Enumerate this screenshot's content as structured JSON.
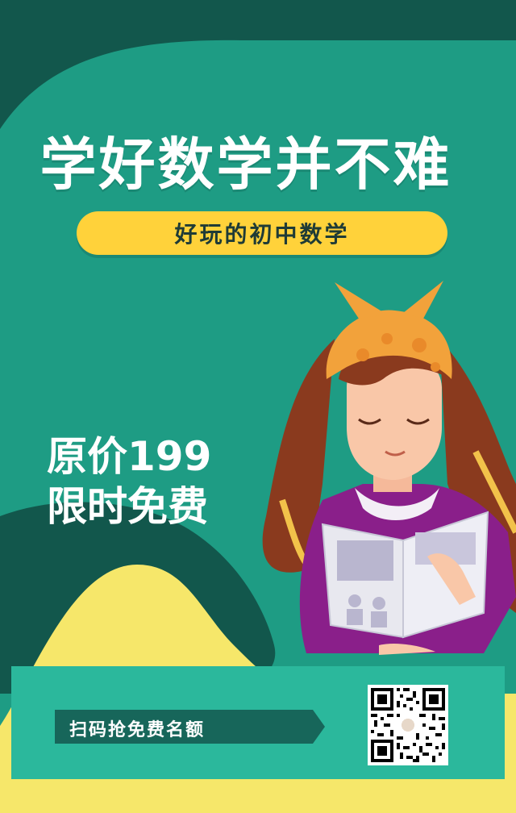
{
  "poster": {
    "title": "学好数学并不难",
    "subtitle": "好玩的初中数学",
    "price_line1": "原价199",
    "price_line2": "限时免费",
    "cta": "扫码抢免费名额"
  },
  "colors": {
    "dark_green": "#12574c",
    "main_green": "#1e9c84",
    "teal_panel": "#2bb89c",
    "yellow": "#ffd23a",
    "hill_yellow": "#f6e76a"
  },
  "icons": {
    "illustration": "girl-reading-book-illustration",
    "qr": "qr-code"
  }
}
